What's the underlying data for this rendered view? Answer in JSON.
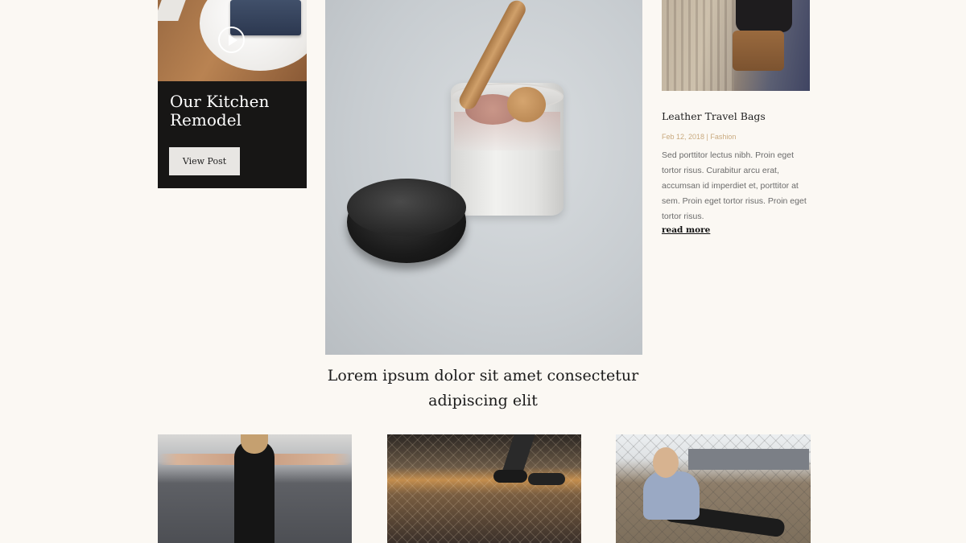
{
  "left_card": {
    "title": "Our Kitchen Remodel",
    "button_label": "View Post"
  },
  "center_feature": {
    "title": "Lorem ipsum dolor sit amet consectetur adipiscing elit"
  },
  "right_card": {
    "title": "Leather Travel Bags",
    "meta": "Feb 12, 2018 | Fashion",
    "excerpt": "Sed porttitor lectus nibh. Proin eget tortor risus. Curabitur arcu erat, accumsan id imperdiet et, porttitor at sem. Proin eget tortor risus. Proin eget tortor risus.",
    "read_more": "read more"
  },
  "icons": {
    "left_card_media": "play-icon"
  },
  "colors": {
    "background": "#fbf8f3",
    "dark_card": "#171615",
    "button_bg": "#e8e6e3",
    "meta_accent": "#c9aa7f"
  }
}
